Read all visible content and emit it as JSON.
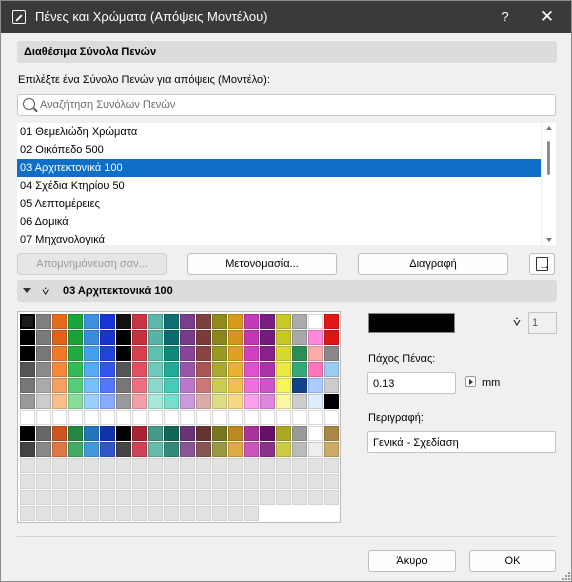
{
  "window": {
    "title": "Πένες και Χρώματα (Απόψεις Μοντέλου)",
    "help": "?",
    "close": "✕"
  },
  "penSets": {
    "header": "Διαθέσιμα Σύνολα Πενών",
    "prompt": "Επιλέξτε ένα Σύνολο Πενών για απόψεις (Μοντέλο):",
    "search_placeholder": "Αναζήτηση Συνόλων Πενών",
    "items": [
      "01 Θεμελιώδη Χρώματα",
      "02 Οικόπεδο 500",
      "03 Αρχιτεκτονικά 100",
      "04 Σχέδια Κτηρίου 50",
      "05 Λεπτομέρειες",
      "06 Δομικά",
      "07 Μηχανολογικά"
    ],
    "selected_index": 2
  },
  "buttons": {
    "store": "Απομνημόνευση σαν...",
    "rename": "Μετονομασία...",
    "delete": "Διαγραφή",
    "cancel": "Άκυρο",
    "ok": "OK"
  },
  "penPanel": {
    "set_name": "03 Αρχιτεκτονικά 100",
    "pen_number": "1",
    "current_color": "#000000",
    "thickness_label": "Πάχος Πένας:",
    "thickness_value": "0.13",
    "unit": "mm",
    "description_label": "Περιγραφή:",
    "description_value": "Γενικά - Σχεδίαση"
  },
  "palette": {
    "columns": 20,
    "total_cells": 255,
    "selected_index": 0,
    "rows": [
      [
        "#1a1a1a",
        "#7f7f7f",
        "#e86b1b",
        "#1aa63c",
        "#3f8fe0",
        "#1a33d6",
        "#111111",
        "#cc3344",
        "#5bb8aa",
        "#0f6f73",
        "#7a3f8c",
        "#7f3f3f",
        "#8f8a1a",
        "#d89a1a",
        "#c43ab8",
        "#7a1f82",
        "#c9c92a",
        "#ababab",
        "#ffffff",
        "#e01818"
      ],
      [
        "#000000",
        "#7a7a7a",
        "#e0621a",
        "#1ba13a",
        "#3a8adf",
        "#1a33cc",
        "#000000",
        "#c83040",
        "#56b3a5",
        "#0d6b70",
        "#773b88",
        "#7a3b3b",
        "#8a861a",
        "#d4951a",
        "#c038b4",
        "#741c7d",
        "#c7c728",
        "#a8a8a8",
        "#ff88dd",
        "#dd1515"
      ],
      [
        "#000000",
        "#787878",
        "#f07a2a",
        "#22aa44",
        "#44a0ee",
        "#2244dd",
        "#000000",
        "#d84050",
        "#60c0b0",
        "#118877",
        "#884499",
        "#884444",
        "#999922",
        "#e0a020",
        "#d040c0",
        "#882288",
        "#d8d830",
        "#2c8c5a",
        "#ffaaaa",
        "#888888"
      ],
      [
        "#555555",
        "#8a8a8a",
        "#f28a3a",
        "#33bb55",
        "#55aaf5",
        "#3355ee",
        "#555555",
        "#e05060",
        "#70cabc",
        "#22aa99",
        "#9955aa",
        "#aa5555",
        "#aaaa33",
        "#eab030",
        "#e050d0",
        "#aa33aa",
        "#eaea40",
        "#33aa77",
        "#ff77bb",
        "#99ccee"
      ],
      [
        "#777777",
        "#aaaaaa",
        "#f5a060",
        "#55cc77",
        "#77c0ff",
        "#5577ff",
        "#777777",
        "#ee7080",
        "#88d8cc",
        "#44ccbb",
        "#bb77cc",
        "#cc7777",
        "#cccc55",
        "#f0c050",
        "#f070e0",
        "#cc55cc",
        "#f5f560",
        "#114488",
        "#aaccff",
        "#cccccc"
      ],
      [
        "#999999",
        "#cccccc",
        "#f8c088",
        "#88dd99",
        "#99d0ff",
        "#88aaff",
        "#999999",
        "#f5a0a8",
        "#a8e8dc",
        "#77ddcc",
        "#cc99dd",
        "#ddaaaa",
        "#dddd88",
        "#f8d888",
        "#f8a0ee",
        "#dd88dd",
        "#f8f8a0",
        "#cccccc",
        "#ddeeff",
        "#000000"
      ],
      [
        "#ffffff",
        "#ffffff",
        "#ffffff",
        "#ffffff",
        "#ffffff",
        "#ffffff",
        "#ffffff",
        "#ffffff",
        "#ffffff",
        "#ffffff",
        "#ffffff",
        "#ffffff",
        "#ffffff",
        "#ffffff",
        "#ffffff",
        "#ffffff",
        "#ffffff",
        "#ffffff",
        "#ffffff",
        "#ffffff"
      ],
      [
        "#000000",
        "#666666",
        "#cc5522",
        "#228844",
        "#2277bb",
        "#1133aa",
        "#000000",
        "#aa2233",
        "#449988",
        "#116655",
        "#663377",
        "#663333",
        "#777722",
        "#bb8822",
        "#aa3399",
        "#661166",
        "#aaaa22",
        "#999999",
        "#ffffff",
        "#aa8844"
      ],
      [
        "#444444",
        "#888888",
        "#dd7744",
        "#44aa66",
        "#4499dd",
        "#3355cc",
        "#444444",
        "#cc4455",
        "#66bbaa",
        "#338877",
        "#885599",
        "#885555",
        "#999944",
        "#ddaa44",
        "#cc55bb",
        "#883388",
        "#cccc44",
        "#bbbbbb",
        "#eeeeee",
        "#ccaa66"
      ]
    ]
  }
}
